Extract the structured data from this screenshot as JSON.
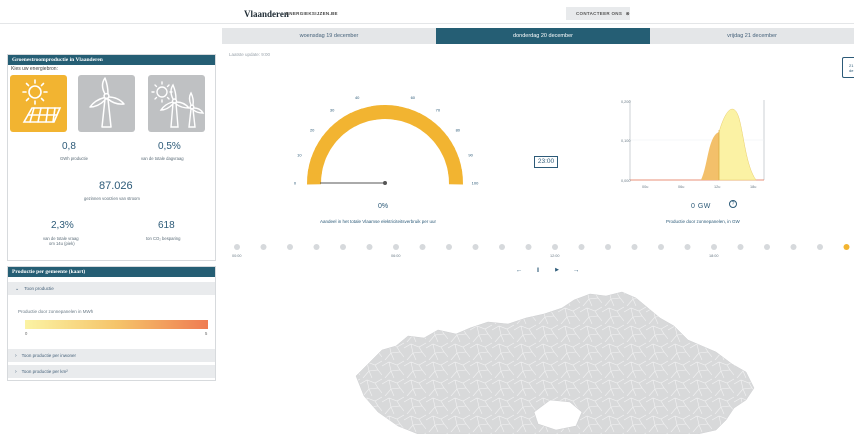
{
  "header": {
    "brand": "Vlaanderen",
    "brand_sub": "ENERGIEKSIJZEN.BE",
    "contact": "CONTACTEER ONS",
    "contact_icon": "close-icon"
  },
  "tabs": [
    {
      "label": "woensdag 19 december",
      "active": false
    },
    {
      "label": "donderdag 20 december",
      "active": true
    },
    {
      "label": "vrijdag 21 december",
      "active": false
    }
  ],
  "sidebar": {
    "title": "Groenestroomproductie in Vlaanderen",
    "choose_label": "Kies uw energiebron:",
    "sources": [
      {
        "icon": "solar-panel-icon",
        "active": true
      },
      {
        "icon": "wind-turbine-icon",
        "active": false
      },
      {
        "icon": "sun-and-wind-icon",
        "active": false
      }
    ],
    "stats": {
      "production_value": "0,8",
      "production_label": "GWh productie",
      "share_value": "0,5%",
      "share_label": "van de totale dagvraag",
      "households_value": "87.026",
      "households_label": "gezinnen voorzien van stroom",
      "demand_value": "2,3%",
      "demand_label_1": "van de totale vraag",
      "demand_label_2": "om 14u (piek)",
      "co2_value": "618",
      "co2_label": "ton CO₂ besparing"
    },
    "map_panel": {
      "title": "Productie per gemeente (kaart)",
      "total_row": "Toon productie",
      "legend_title": "Productie door zonnepanelen in MWh",
      "legend_min": "0",
      "legend_max": "5",
      "per_resident_row": "Toon productie per inwoner",
      "per_km2_row": "Toon productie per km²",
      "colors": {
        "low": "#fbf3a4",
        "mid": "#f5c46a",
        "high": "#ef7c52"
      }
    }
  },
  "main": {
    "last_update": "Laatste update: 9:00",
    "gauge": {
      "value_text": "0%",
      "caption": "Aandeel in het totale Vlaamse elektriciteitsverbruik per uur",
      "ticks": [
        "0",
        "10",
        "20",
        "30",
        "40",
        "50",
        "60",
        "70",
        "80",
        "90",
        "100"
      ],
      "value": 0,
      "color": "#f2b431"
    },
    "clock": "23:00",
    "production": {
      "value_text": "0 GW",
      "caption": "Productie door zonnepanelen, in GW",
      "y_ticks": [
        "0,200",
        "0,100",
        "0,000"
      ],
      "x_ticks": [
        "00u",
        "06u",
        "12u",
        "18u"
      ]
    },
    "timeline": {
      "labels": [
        "00:00",
        "06:00",
        "12:00",
        "18:00"
      ],
      "active_index": 23,
      "active_color": "#f2b431"
    },
    "controls": {
      "prev": "←",
      "pause": "‖",
      "play": "▶",
      "next": "→"
    }
  }
}
